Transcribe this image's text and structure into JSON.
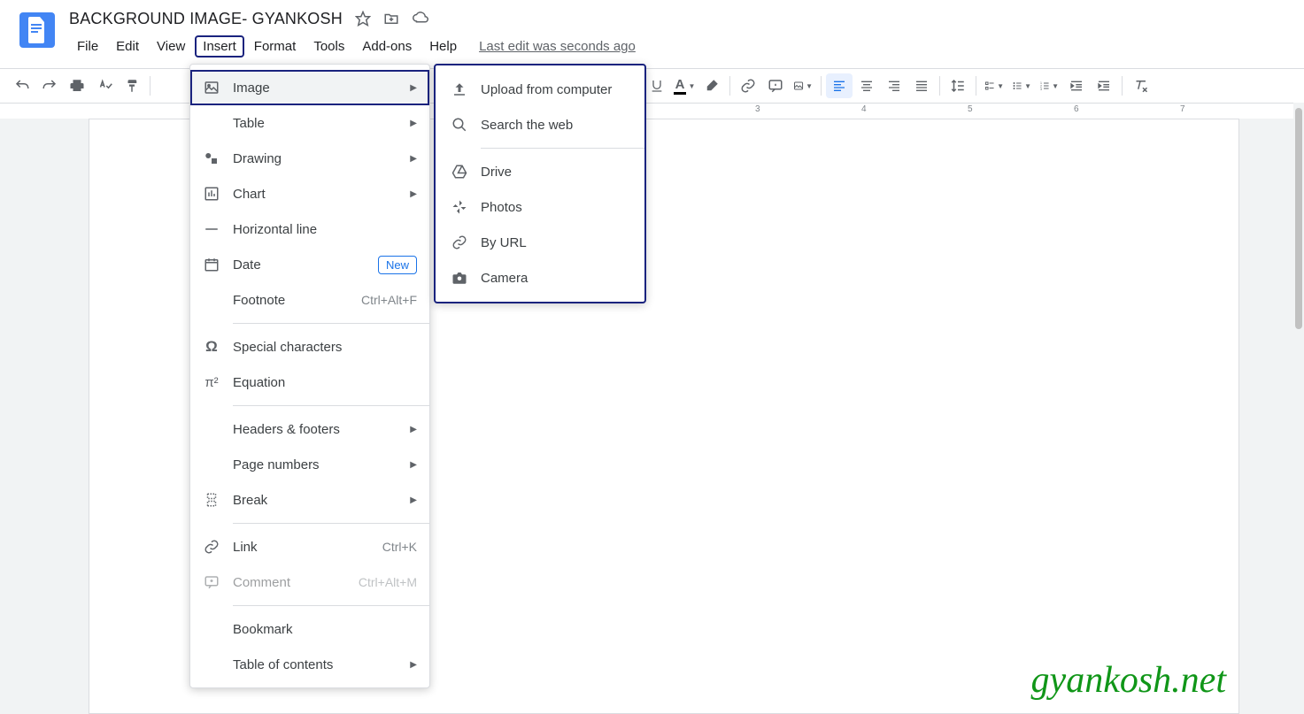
{
  "doc_title": "BACKGROUND IMAGE- GYANKOSH",
  "menus": {
    "file": "File",
    "edit": "Edit",
    "view": "View",
    "insert": "Insert",
    "format": "Format",
    "tools": "Tools",
    "addons": "Add-ons",
    "help": "Help"
  },
  "last_edit": "Last edit was seconds ago",
  "insert_menu": {
    "image": "Image",
    "table": "Table",
    "drawing": "Drawing",
    "chart": "Chart",
    "hline": "Horizontal line",
    "date": "Date",
    "date_new": "New",
    "footnote": "Footnote",
    "footnote_sc": "Ctrl+Alt+F",
    "special": "Special characters",
    "equation": "Equation",
    "headers": "Headers & footers",
    "pagenum": "Page numbers",
    "break": "Break",
    "link": "Link",
    "link_sc": "Ctrl+K",
    "comment": "Comment",
    "comment_sc": "Ctrl+Alt+M",
    "bookmark": "Bookmark",
    "toc": "Table of contents"
  },
  "image_submenu": {
    "upload": "Upload from computer",
    "search": "Search the web",
    "drive": "Drive",
    "photos": "Photos",
    "url": "By URL",
    "camera": "Camera"
  },
  "ruler": [
    "3",
    "4",
    "5",
    "6",
    "7"
  ],
  "watermark": "gyankosh.net"
}
